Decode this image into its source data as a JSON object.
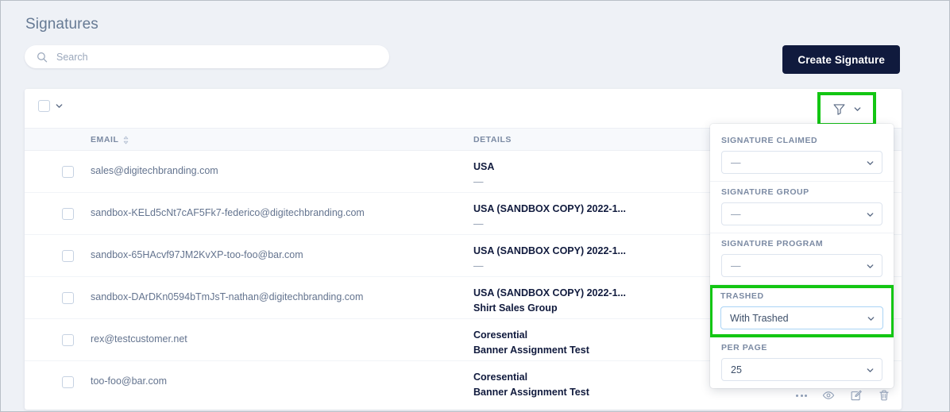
{
  "page": {
    "title": "Signatures"
  },
  "search": {
    "placeholder": "Search",
    "value": ""
  },
  "header": {
    "create_button": "Create Signature"
  },
  "toolbar": {
    "bulk_select_checked": false,
    "filter_icon": "funnel-icon",
    "filter_chevron": "chevron-down-icon"
  },
  "table": {
    "columns": [
      {
        "key": "email",
        "label": "EMAIL",
        "sortable": true
      },
      {
        "key": "details",
        "label": "DETAILS",
        "sortable": false
      }
    ],
    "rows": [
      {
        "email": "sales@digitechbranding.com",
        "detail_primary": "USA",
        "detail_secondary": "—",
        "detail_secondary_is_dash": true
      },
      {
        "email": "sandbox-KELd5cNt7cAF5Fk7-federico@digitechbranding.com",
        "detail_primary": "USA (SANDBOX COPY) 2022-1...",
        "detail_secondary": "—",
        "detail_secondary_is_dash": true
      },
      {
        "email": "sandbox-65HAcvf97JM2KvXP-too-foo@bar.com",
        "detail_primary": "USA (SANDBOX COPY) 2022-1...",
        "detail_secondary": "—",
        "detail_secondary_is_dash": true
      },
      {
        "email": "sandbox-DArDKn0594bTmJsT-nathan@digitechbranding.com",
        "detail_primary": "USA (SANDBOX COPY) 2022-1...",
        "detail_secondary": "Shirt Sales Group",
        "detail_secondary_is_dash": false
      },
      {
        "email": "rex@testcustomer.net",
        "detail_primary": "Coresential",
        "detail_secondary": "Banner Assignment Test",
        "detail_secondary_is_dash": false
      },
      {
        "email": "too-foo@bar.com",
        "detail_primary": "Coresential",
        "detail_secondary": "Banner Assignment Test",
        "detail_secondary_is_dash": false
      }
    ]
  },
  "filter_panel": {
    "groups": [
      {
        "label": "SIGNATURE CLAIMED",
        "value": "—",
        "is_dash": true,
        "highlighted": false,
        "focused": false
      },
      {
        "label": "SIGNATURE GROUP",
        "value": "—",
        "is_dash": true,
        "highlighted": false,
        "focused": false
      },
      {
        "label": "SIGNATURE PROGRAM",
        "value": "—",
        "is_dash": true,
        "highlighted": false,
        "focused": false
      },
      {
        "label": "TRASHED",
        "value": "With Trashed",
        "is_dash": false,
        "highlighted": true,
        "focused": true
      },
      {
        "label": "PER PAGE",
        "value": "25",
        "is_dash": false,
        "highlighted": false,
        "focused": false
      }
    ]
  },
  "row_actions": [
    {
      "name": "more-icon",
      "label": "More"
    },
    {
      "name": "eye-icon",
      "label": "View"
    },
    {
      "name": "edit-icon",
      "label": "Edit"
    },
    {
      "name": "trash-icon",
      "label": "Delete"
    }
  ],
  "colors": {
    "highlight": "#13c613",
    "brand_dark": "#101a3d",
    "page_bg": "#eef1f6",
    "focus_border": "#aad4f5"
  }
}
